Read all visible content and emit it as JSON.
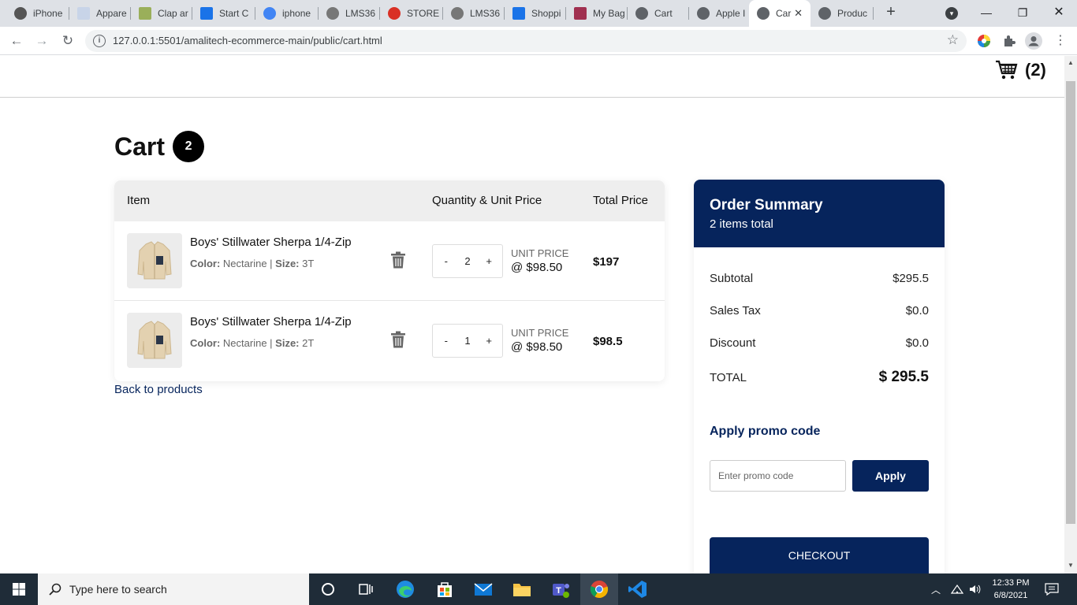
{
  "browser": {
    "tabs": [
      {
        "label": "iPhone",
        "color": "#555555"
      },
      {
        "label": "Appare",
        "color": "#c8d4e8"
      },
      {
        "label": "Clap ar",
        "color": "#9aaf5a"
      },
      {
        "label": "Start C",
        "color": "#1a73e8"
      },
      {
        "label": "iphone",
        "color": "#4285f4"
      },
      {
        "label": "LMS36",
        "color": "#777777"
      },
      {
        "label": "STORE",
        "color": "#d93025"
      },
      {
        "label": "LMS36",
        "color": "#777777"
      },
      {
        "label": "Shoppi",
        "color": "#1a73e8"
      },
      {
        "label": "My Bag",
        "color": "#a03050"
      },
      {
        "label": "Cart",
        "color": "#5f6368"
      },
      {
        "label": "Apple I",
        "color": "#5f6368"
      },
      {
        "label": "Car",
        "color": "#5f6368"
      },
      {
        "label": "Produc",
        "color": "#5f6368"
      }
    ],
    "url": "127.0.0.1:5501/amalitech-ecommerce-main/public/cart.html"
  },
  "header": {
    "cart_count": "(2)"
  },
  "cart": {
    "title": "Cart",
    "badge": "2",
    "columns": {
      "item": "Item",
      "qty_price": "Quantity & Unit Price",
      "total": "Total Price"
    },
    "items": [
      {
        "name": "Boys' Stillwater Sherpa 1/4-Zip",
        "color_label": "Color:",
        "color": "Nectarine",
        "size_label": "Size:",
        "size": "3T",
        "qty": "2",
        "unit_label": "UNIT PRICE",
        "unit_price": "@ $98.50",
        "total": "$197"
      },
      {
        "name": "Boys' Stillwater Sherpa 1/4-Zip",
        "color_label": "Color:",
        "color": "Nectarine",
        "size_label": "Size:",
        "size": "2T",
        "qty": "1",
        "unit_label": "UNIT PRICE",
        "unit_price": "@ $98.50",
        "total": "$98.5"
      }
    ],
    "minus": "-",
    "plus": "+",
    "back_link": "Back to products"
  },
  "summary": {
    "title": "Order Summary",
    "subtitle": "2 items total",
    "subtotal_label": "Subtotal",
    "subtotal": "$295.5",
    "tax_label": "Sales Tax",
    "tax": "$0.0",
    "discount_label": "Discount",
    "discount": "$0.0",
    "total_label": "TOTAL",
    "total": "$ 295.5",
    "promo_title": "Apply promo code",
    "promo_placeholder": "Enter promo code",
    "apply_label": "Apply",
    "checkout_label": "CHECKOUT"
  },
  "taskbar": {
    "search_placeholder": "Type here to search",
    "time": "12:33 PM",
    "date": "6/8/2021"
  },
  "colors": {
    "brand": "#06245c",
    "badge": "#000000"
  }
}
